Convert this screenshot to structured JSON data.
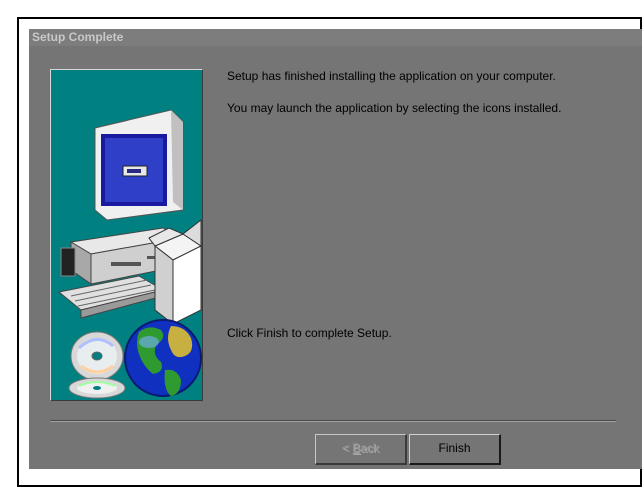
{
  "window": {
    "title": "Setup Complete"
  },
  "message": {
    "line1": "Setup has finished installing the application on your computer.",
    "line2": "You may launch the application by selecting the icons installed.",
    "line3": "Click Finish to complete Setup."
  },
  "buttons": {
    "back_prefix": "< ",
    "back_hotkey": "B",
    "back_rest": "ack",
    "back_enabled": false,
    "finish_label": "Finish"
  },
  "colors": {
    "dialog_bg": "#757575",
    "panel_bg": "#008080"
  }
}
